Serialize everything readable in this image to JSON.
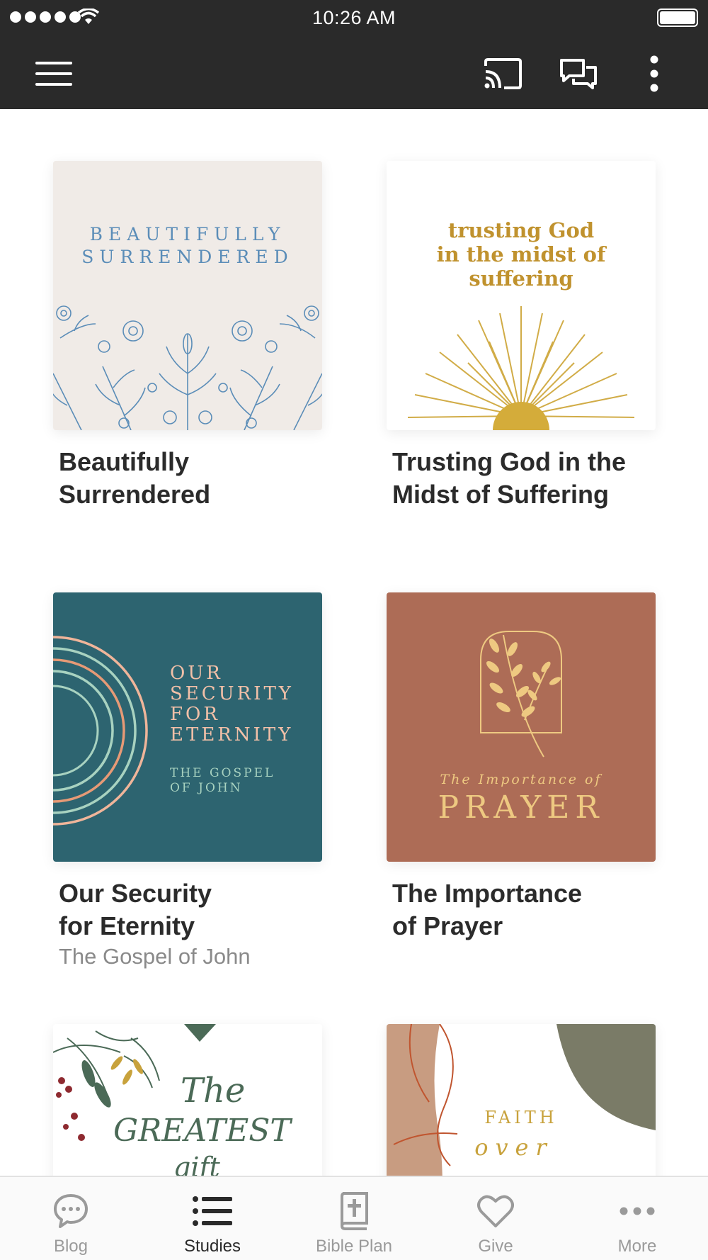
{
  "status_bar": {
    "time": "10:26 AM"
  },
  "cards": [
    {
      "title": "Beautifully\nSurrendered",
      "subtitle": "",
      "cover_text": [
        "BEAUTIFULLY",
        "SURRENDERED"
      ]
    },
    {
      "title": "Trusting God in the\nMidst of Suffering",
      "subtitle": "",
      "cover_text": [
        "trusting God",
        "in the midst of",
        "suffering"
      ]
    },
    {
      "title": "Our Security\nfor Eternity",
      "subtitle": "The Gospel of John",
      "cover_text": [
        "OUR",
        "SECURITY",
        "FOR",
        "ETERNITY",
        "THE GOSPEL",
        "OF JOHN"
      ]
    },
    {
      "title": "The Importance\nof Prayer",
      "subtitle": "",
      "cover_text": [
        "The Importance of",
        "PRAYER"
      ]
    },
    {
      "title": "",
      "subtitle": "",
      "cover_text": [
        "The",
        "GREATEST",
        "gift"
      ]
    },
    {
      "title": "",
      "subtitle": "",
      "cover_text": [
        "FAITH",
        "over"
      ]
    }
  ],
  "tabs": [
    {
      "label": "Blog",
      "icon": "chat-bubble-icon"
    },
    {
      "label": "Studies",
      "icon": "list-icon",
      "active": true
    },
    {
      "label": "Bible Plan",
      "icon": "bible-icon"
    },
    {
      "label": "Give",
      "icon": "heart-icon"
    },
    {
      "label": "More",
      "icon": "more-dots-icon"
    }
  ],
  "colors": {
    "toolbar": "#2a2a2a",
    "teal_cover": "#2d6470",
    "terracotta_cover": "#ad6c56",
    "gold": "#c8a23c",
    "blue_line": "#5b8db8",
    "active_tab": "#2a2a2a",
    "inactive_tab": "#9a9a9a"
  }
}
